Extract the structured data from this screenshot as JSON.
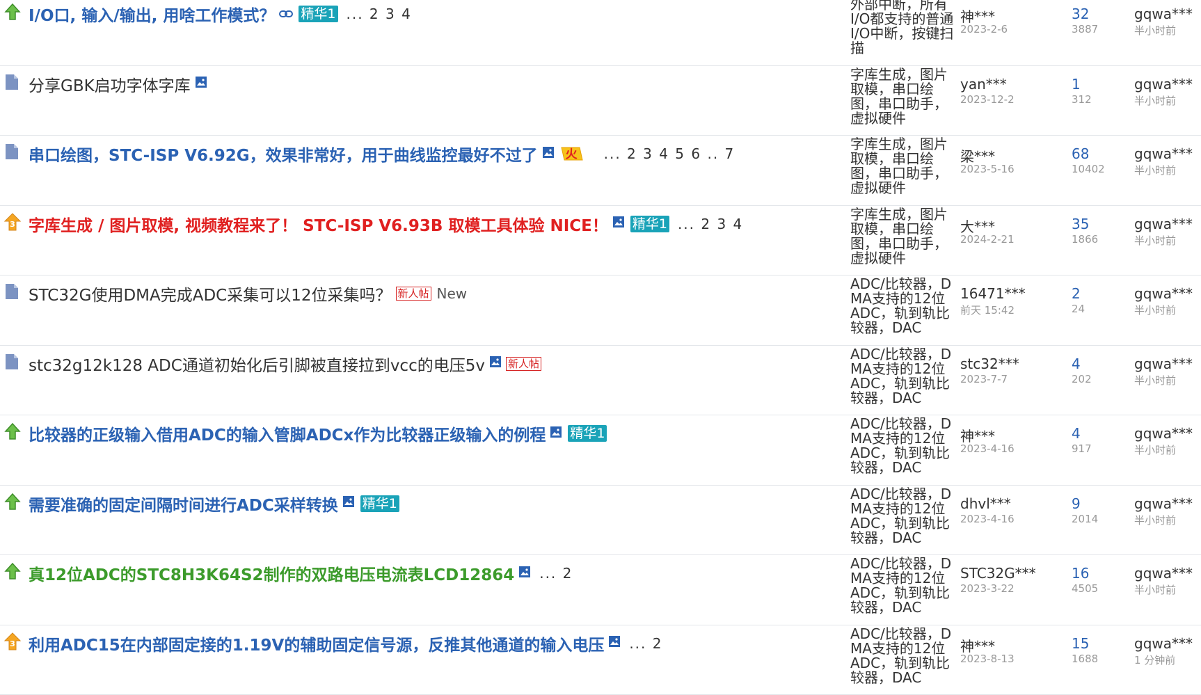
{
  "threads": [
    {
      "icon": "hot-up-arrow-icon",
      "title": "I/O口, 输入/输出, 用啥工作模式？",
      "title_style": "bold blue",
      "has_link_icon": true,
      "has_image_icon": false,
      "badge": "精华1",
      "new_badge": "",
      "new_text": "",
      "hot": false,
      "pages": "... 2 3 4",
      "tags": "外部中断，所有I/O都支持的普通I/O中断，按键扫描",
      "author": "神***",
      "author_date": "2023-2-6",
      "replies": "32",
      "views": "3887",
      "last_user": "gqwa***",
      "last_time": "半小时前"
    },
    {
      "icon": "document-icon",
      "title": "分享GBK启功字体字库",
      "title_style": "plain",
      "has_link_icon": false,
      "has_image_icon": true,
      "badge": "",
      "new_badge": "",
      "new_text": "",
      "hot": false,
      "pages": "",
      "tags": "字库生成，图片取模，串口绘图，串口助手，虚拟硬件",
      "author": "yan***",
      "author_date": "2023-12-2",
      "replies": "1",
      "views": "312",
      "last_user": "gqwa***",
      "last_time": "半小时前"
    },
    {
      "icon": "document-icon",
      "title": "串口绘图，STC-ISP V6.92G，效果非常好，用于曲线监控最好不过了",
      "title_style": "bold blue",
      "has_link_icon": false,
      "has_image_icon": true,
      "badge": "",
      "new_badge": "",
      "new_text": "",
      "hot": true,
      "hot_label": "火",
      "pages": "... 2 3 4 5 6 .. 7",
      "tags": "字库生成，图片取模，串口绘图，串口助手，虚拟硬件",
      "author": "梁***",
      "author_date": "2023-5-16",
      "replies": "68",
      "views": "10402",
      "last_user": "gqwa***",
      "last_time": "半小时前"
    },
    {
      "icon": "top-3-icon",
      "title": "字库生成 / 图片取模, 视频教程来了！ STC-ISP V6.93B 取模工具体验 NICE！",
      "title_style": "bold red",
      "has_link_icon": false,
      "has_image_icon": true,
      "badge": "精华1",
      "new_badge": "",
      "new_text": "",
      "hot": false,
      "pages": "... 2 3 4",
      "tags": "字库生成，图片取模，串口绘图，串口助手，虚拟硬件",
      "author": "大***",
      "author_date": "2024-2-21",
      "replies": "35",
      "views": "1866",
      "last_user": "gqwa***",
      "last_time": "半小时前"
    },
    {
      "icon": "document-icon",
      "title": "STC32G使用DMA完成ADC采集可以12位采集吗？",
      "title_style": "plain",
      "has_link_icon": false,
      "has_image_icon": false,
      "badge": "",
      "new_badge": "新人帖",
      "new_text": "New",
      "hot": false,
      "pages": "",
      "tags": "ADC/比较器，DMA支持的12位ADC，轨到轨比较器，DAC",
      "author": "16471***",
      "author_date": "前天 15:42",
      "replies": "2",
      "views": "24",
      "last_user": "gqwa***",
      "last_time": "半小时前"
    },
    {
      "icon": "document-icon",
      "title": "stc32g12k128 ADC通道初始化后引脚被直接拉到vcc的电压5v",
      "title_style": "plain",
      "has_link_icon": false,
      "has_image_icon": true,
      "badge": "",
      "new_badge": "新人帖",
      "new_text": "",
      "hot": false,
      "pages": "",
      "tags": "ADC/比较器，DMA支持的12位ADC，轨到轨比较器，DAC",
      "author": "stc32***",
      "author_date": "2023-7-7",
      "replies": "4",
      "views": "202",
      "last_user": "gqwa***",
      "last_time": "半小时前"
    },
    {
      "icon": "hot-up-arrow-icon",
      "title": "比较器的正级输入借用ADC的输入管脚ADCx作为比较器正级输入的例程",
      "title_style": "bold blue",
      "has_link_icon": false,
      "has_image_icon": true,
      "badge": "精华1",
      "new_badge": "",
      "new_text": "",
      "hot": false,
      "pages": "",
      "tags": "ADC/比较器，DMA支持的12位ADC，轨到轨比较器，DAC",
      "author": "神***",
      "author_date": "2023-4-16",
      "replies": "4",
      "views": "917",
      "last_user": "gqwa***",
      "last_time": "半小时前"
    },
    {
      "icon": "hot-up-arrow-icon",
      "title": "需要准确的固定间隔时间进行ADC采样转换",
      "title_style": "bold blue",
      "has_link_icon": false,
      "has_image_icon": true,
      "badge": "精华1",
      "new_badge": "",
      "new_text": "",
      "hot": false,
      "pages": "",
      "tags": "ADC/比较器，DMA支持的12位ADC，轨到轨比较器，DAC",
      "author": "dhvl***",
      "author_date": "2023-4-16",
      "replies": "9",
      "views": "2014",
      "last_user": "gqwa***",
      "last_time": "半小时前"
    },
    {
      "icon": "hot-up-arrow-icon",
      "title": "真12位ADC的STC8H3K64S2制作的双路电压电流表LCD12864",
      "title_style": "bold green",
      "has_link_icon": false,
      "has_image_icon": true,
      "badge": "",
      "new_badge": "",
      "new_text": "",
      "hot": false,
      "pages": "... 2",
      "tags": "ADC/比较器，DMA支持的12位ADC，轨到轨比较器，DAC",
      "author": "STC32G***",
      "author_date": "2023-3-22",
      "replies": "16",
      "views": "4505",
      "last_user": "gqwa***",
      "last_time": "半小时前"
    },
    {
      "icon": "top-3-icon",
      "title": "利用ADC15在内部固定接的1.19V的辅助固定信号源，反推其他通道的输入电压",
      "title_style": "bold blue",
      "has_link_icon": false,
      "has_image_icon": true,
      "badge": "",
      "new_badge": "",
      "new_text": "",
      "hot": false,
      "pages": "... 2",
      "tags": "ADC/比较器，DMA支持的12位ADC，轨到轨比较器，DAC",
      "author": "神***",
      "author_date": "2023-8-13",
      "replies": "15",
      "views": "1688",
      "last_user": "gqwa***",
      "last_time": "1 分钟前"
    }
  ]
}
